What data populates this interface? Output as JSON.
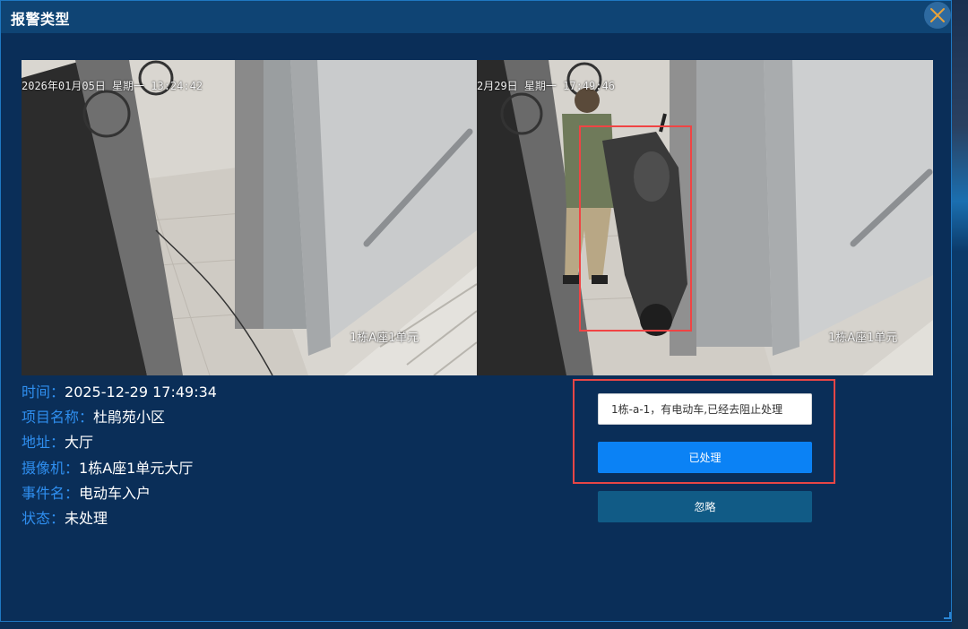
{
  "dialog": {
    "title": "报警类型",
    "close_icon": "close-icon",
    "accent_color": "#2f8ff0",
    "close_icon_color": "#e8a23a"
  },
  "snapshots": [
    {
      "osd_time": "2026年01月05日 星期一 13:24:42",
      "osd_camera": "1栋A座1单元"
    },
    {
      "osd_time": "2月29日 星期一 17:49:46",
      "osd_camera": "1栋A座1单元"
    }
  ],
  "details": [
    {
      "label": "时间：",
      "value": "2025-12-29 17:49:34"
    },
    {
      "label": "项目名称：",
      "value": "杜鹃苑小区"
    },
    {
      "label": "地址：",
      "value": "大厅"
    },
    {
      "label": "摄像机：",
      "value": "1栋A座1单元大厅"
    },
    {
      "label": "事件名：",
      "value": "电动车入户"
    },
    {
      "label": "状态：",
      "value": "未处理"
    }
  ],
  "actions": {
    "remark_value": "1栋-a-1，有电动车,已经去阻止处理",
    "processed_label": "已处理",
    "ignore_label": "忽略",
    "primary_color": "#0b82f5",
    "secondary_color": "#115b86"
  }
}
